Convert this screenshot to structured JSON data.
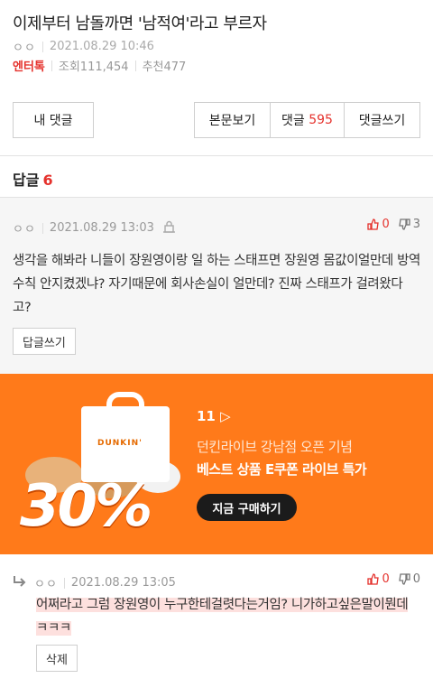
{
  "post": {
    "title": "이제부터 남돌까면 '남적여'라고 부르자",
    "author": "ㅇㅇ",
    "date": "2021.08.29 10:46",
    "category": "엔터톡",
    "views": "조회111,454",
    "recommends": "추천477"
  },
  "buttons": {
    "my_comments": "내 댓글",
    "view_post": "본문보기",
    "comments_label": "댓글",
    "comments_count": "595",
    "write_comment": "댓글쓰기"
  },
  "replies": {
    "label": "답글",
    "count": "6"
  },
  "comment": {
    "author": "ㅇㅇ",
    "date": "2021.08.29 13:03",
    "up": "0",
    "down": "3",
    "text": "생각을 해봐라 니들이 장원영이랑 일 하는 스태프면 장원영 몸값이얼만데 방역수칙 안지켰겠냐? 자기때문에 회사손실이 얼만데? 진짜 스태프가 걸려왔다고?",
    "reply_button": "답글쓰기"
  },
  "ad": {
    "brand": "DUNKIN'",
    "logo": "11",
    "tagline": "던킨라이브 강남점 오픈 기념",
    "promo": "베스트 상품 E쿠폰 라이브 특가",
    "discount": "30%",
    "cta": "지금 구매하기"
  },
  "reply": {
    "author": "ㅇㅇ",
    "date": "2021.08.29 13:05",
    "up": "0",
    "down": "0",
    "text": "어쩌라고 그럼 장원영이 누구한테걸렷다는거임? 니가하고싶은말이뭔데 ㅋㅋㅋ",
    "delete_button": "삭제"
  },
  "colors": {
    "accent": "#e5322d",
    "ad_bg": "#ff7a1a"
  }
}
